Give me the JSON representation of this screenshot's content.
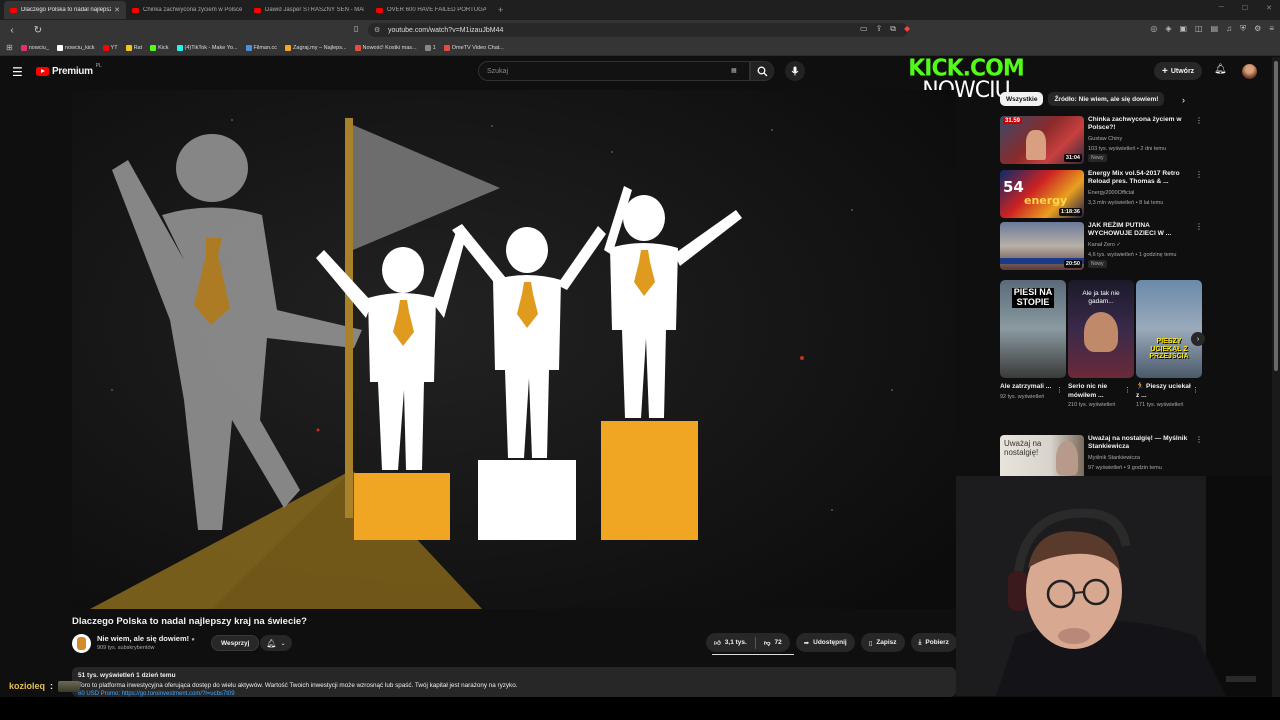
{
  "browser": {
    "tabs": [
      {
        "title": "Dlaczego Polska to nadal najlepszy",
        "active": true
      },
      {
        "title": "Chinka zachwycona życiem w Polsce",
        "active": false
      },
      {
        "title": "Dawid Jasper STRASZNY SEN - MAF",
        "active": false
      },
      {
        "title": "OVER 600 HAVE FAILED PORTUGAL'S",
        "active": false
      }
    ],
    "url": "youtube.com/watch?v=M1izauJbM44",
    "bookmarks": [
      {
        "label": "nowciu_",
        "color": "#e1306c"
      },
      {
        "label": "nowciu_kick",
        "color": "#ffffff"
      },
      {
        "label": "YT",
        "color": "#ff0000"
      },
      {
        "label": "Rat",
        "color": "#f5c518"
      },
      {
        "label": "Kick",
        "color": "#53fc18"
      },
      {
        "label": "(4)TikTok - Make Yo...",
        "color": "#25f4ee"
      },
      {
        "label": "Filman.cc",
        "color": "#4a90e2"
      },
      {
        "label": "Zagraj.my – Najleps...",
        "color": "#f5a623"
      },
      {
        "label": "Nowość! Kostki mas...",
        "color": "#e74c3c"
      },
      {
        "label": "1",
        "color": "#888888"
      },
      {
        "label": "OmeTV Video Chat...",
        "color": "#e74c3c"
      }
    ]
  },
  "header": {
    "logo_text": "Premium",
    "logo_region": "PL",
    "search_placeholder": "Szukaj",
    "create_label": "Utwórz"
  },
  "overlay": {
    "line1": "KICK.COM",
    "line2": "NOWCIU"
  },
  "video": {
    "title": "Dlaczego Polska to nadal najlepszy kraj na świecie?",
    "channel": "Nie wiem, ale się dowiem!",
    "subscribers": "909 tys. subskrybentów",
    "support_label": "Wesprzyj",
    "likes": "3,1 tys.",
    "dislikes": "72",
    "share_label": "Udostępnij",
    "save_label": "Zapisz",
    "download_label": "Pobierz",
    "description_meta": "51 tys. wyświetleń  1 dzień temu",
    "description_text": "Toro to platforma inwestycyjna oferująca dostęp do wielu aktywów. Wartość Twoich inwestycji może wzrosnąć lub spaść. Twój kapitał jest narażony na ryzyko.",
    "description_link": "60 USD Promo: https://go.toroinvestment.com/?l=ucbs7t09"
  },
  "chat": {
    "user": "kozioleq",
    "colon": ":"
  },
  "sidebar": {
    "chips": [
      {
        "label": "Wszystkie",
        "active": true
      },
      {
        "label": "Źródło: Nie wiem, ale się dowiem!",
        "active": false
      }
    ],
    "recommendations": [
      {
        "title": "Chinka zachwycona życiem w Polsce?!",
        "channel": "Gustaw Chiny",
        "meta": "103 tys. wyświetleń • 2 dni temu",
        "badge": "Nowy",
        "duration": "31:04"
      },
      {
        "title": "Energy Mix vol.54-2017 Retro Reload pres. Thomas & ...",
        "channel": "Energy2000Official",
        "meta": "3,3 mln wyświetleń • 8 lat temu",
        "badge": "",
        "duration": "1:18:36"
      },
      {
        "title": "JAK REŻIM PUTINA WYCHOWUJE DZIECI W ...",
        "channel": "Kanał Zero ✓",
        "meta": "4,6 tys. wyświetleń • 1 godzinę temu",
        "badge": "Nowy",
        "duration": "20:50"
      },
      {
        "title": "Uważaj na nostalgię! — Myślnik Stankiewicza",
        "channel": "Myślnik Stankiewicza",
        "meta": "97 wyświetleń • 9 godzin temu",
        "badge": "",
        "duration": ""
      }
    ],
    "shorts": [
      {
        "title": "Ale zatrzymali ...",
        "views": "92 tys. wyświetleń",
        "thumb_text": "PIESI NA STOPIE"
      },
      {
        "title": "Serio nic nie mówiłem ...",
        "views": "210 tys. wyświetleń",
        "thumb_text": "Ale ja tak nie gadam..."
      },
      {
        "title": "🏃 Pieszy uciekał z ...",
        "views": "171 tys. wyświetleń",
        "thumb_text": "PIESZY UCIEKAŁ Z PRZEJŚCIA"
      }
    ],
    "rec4_thumb_text": "Uważaj na nostalgię!"
  },
  "colors": {
    "accent_red": "#ff0000",
    "kick_green": "#53fc18",
    "podium_gold": "#f0a623",
    "link_blue": "#3ea6ff"
  }
}
